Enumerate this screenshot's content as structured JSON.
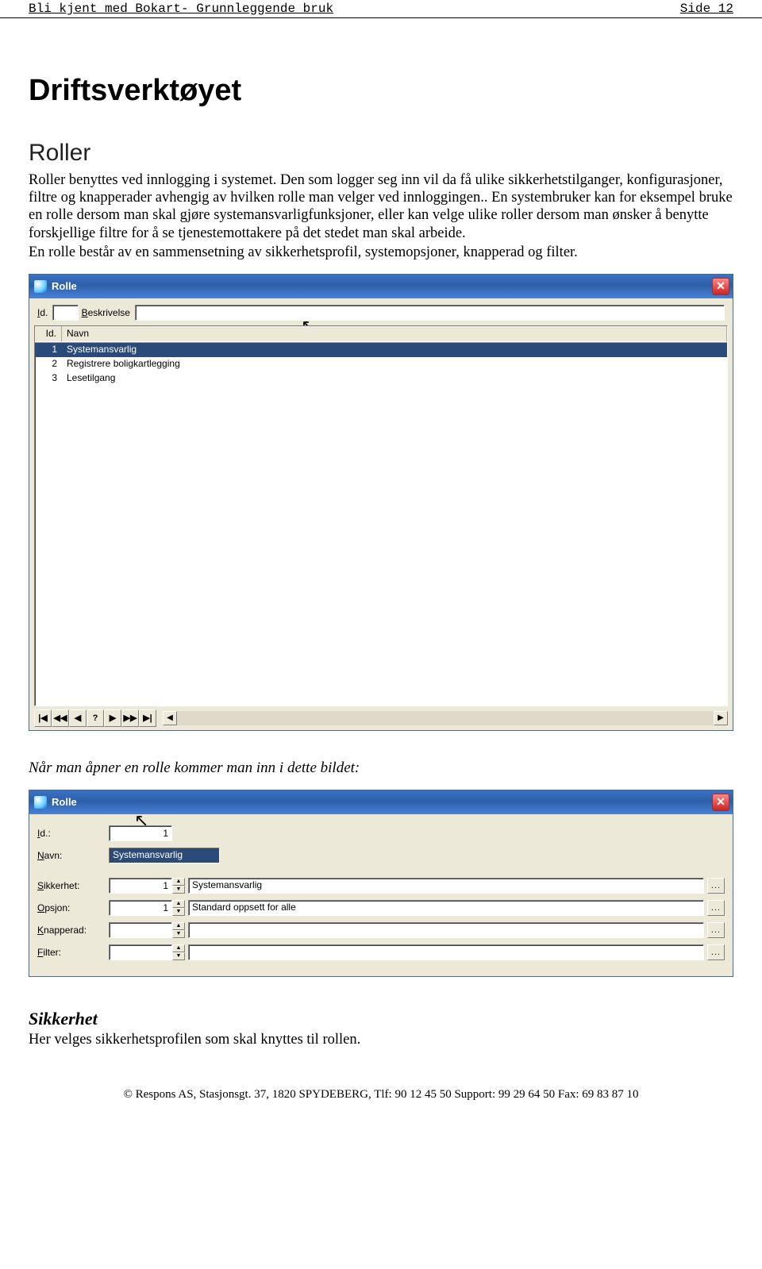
{
  "header": {
    "left": "Bli kjent med Bokart- Grunnleggende bruk",
    "right": "Side 12"
  },
  "headings": {
    "main": "Driftsverktøyet",
    "roller": "Roller",
    "caption2": "Når man åpner en rolle kommer man inn i dette bildet:",
    "sikkerhet": "Sikkerhet"
  },
  "paragraphs": {
    "p1": "Roller benyttes ved innlogging i systemet. Den som logger seg inn vil da få ulike sikkerhetstilganger, konfigurasjoner, filtre og knapperader avhengig av hvilken rolle man velger ved innloggingen.. En systembruker kan for eksempel bruke en rolle dersom man skal gjøre systemansvarligfunksjoner, eller kan velge ulike roller dersom man ønsker å benytte forskjellige filtre for å se tjenestemottakere på det stedet man skal arbeide.",
    "p2": "En rolle består av en sammensetning av sikkerhetsprofil, systemopsjoner, knapperad og filter.",
    "p_sikkerhet": "Her velges sikkerhetsprofilen som skal knyttes til rollen."
  },
  "dialog1": {
    "title": "Rolle",
    "filter_id_label": "Id.",
    "filter_desc_label": "Beskrivelse",
    "grid": {
      "col_id": "Id.",
      "col_name": "Navn",
      "rows": [
        {
          "id": "1",
          "name": "Systemansvarlig"
        },
        {
          "id": "2",
          "name": "Registrere boligkartlegging"
        },
        {
          "id": "3",
          "name": "Lesetilgang"
        }
      ]
    },
    "nav": [
      "|◀",
      "◀◀",
      "◀",
      "?",
      "▶",
      "▶▶",
      "▶|"
    ]
  },
  "dialog2": {
    "title": "Rolle",
    "labels": {
      "id": "Id.:",
      "navn": "Navn:",
      "sikkerhet": "Sikkerhet:",
      "opsjon": "Opsjon:",
      "knapperad": "Knapperad:",
      "filter": "Filter:"
    },
    "values": {
      "id": "1",
      "navn": "Systemansvarlig",
      "sikkerhet_num": "1",
      "sikkerhet_desc": "Systemansvarlig",
      "opsjon_num": "1",
      "opsjon_desc": "Standard oppsett for alle",
      "knapperad_num": "",
      "knapperad_desc": "",
      "filter_num": "",
      "filter_desc": ""
    },
    "dots": "..."
  },
  "footer": "© Respons AS, Stasjonsgt. 37, 1820 SPYDEBERG, Tlf: 90 12 45 50 Support: 99 29 64 50 Fax: 69 83 87 10"
}
